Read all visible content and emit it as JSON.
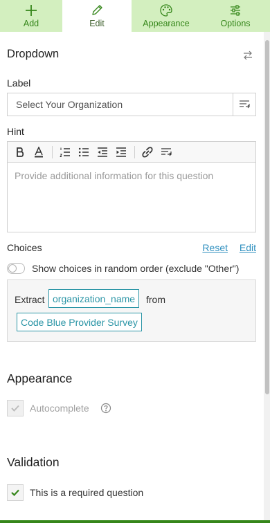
{
  "tabs": [
    {
      "label": "Add",
      "icon": "plus-icon"
    },
    {
      "label": "Edit",
      "icon": "pencil-icon"
    },
    {
      "label": "Appearance",
      "icon": "palette-icon"
    },
    {
      "label": "Options",
      "icon": "sliders-icon"
    }
  ],
  "active_tab": "Edit",
  "colors": {
    "accent": "#35861a",
    "tab_bg": "#d3efbf",
    "link": "#2e8fbf",
    "chip": "#2b95a6"
  },
  "question": {
    "type_title": "Dropdown",
    "label_heading": "Label",
    "label_value": "Select Your Organization",
    "hint_heading": "Hint",
    "hint_placeholder": "Provide additional information for this question",
    "toolbar_icons": [
      "bold-icon",
      "font-color-icon",
      "numbered-list-icon",
      "bulleted-list-icon",
      "outdent-icon",
      "indent-icon",
      "link-icon",
      "insert-text-icon"
    ]
  },
  "choices": {
    "heading": "Choices",
    "reset_label": "Reset",
    "edit_label": "Edit",
    "random_order_label": "Show choices in random order (exclude \"Other\")",
    "random_order_on": false,
    "extract_label": "Extract",
    "extract_field": "organization_name",
    "from_label": "from",
    "source_survey": "Code Blue Provider Survey"
  },
  "appearance": {
    "heading": "Appearance",
    "autocomplete_label": "Autocomplete",
    "autocomplete_checked": true,
    "autocomplete_disabled": true
  },
  "validation": {
    "heading": "Validation",
    "required_label": "This is a required question",
    "required_checked": true
  }
}
